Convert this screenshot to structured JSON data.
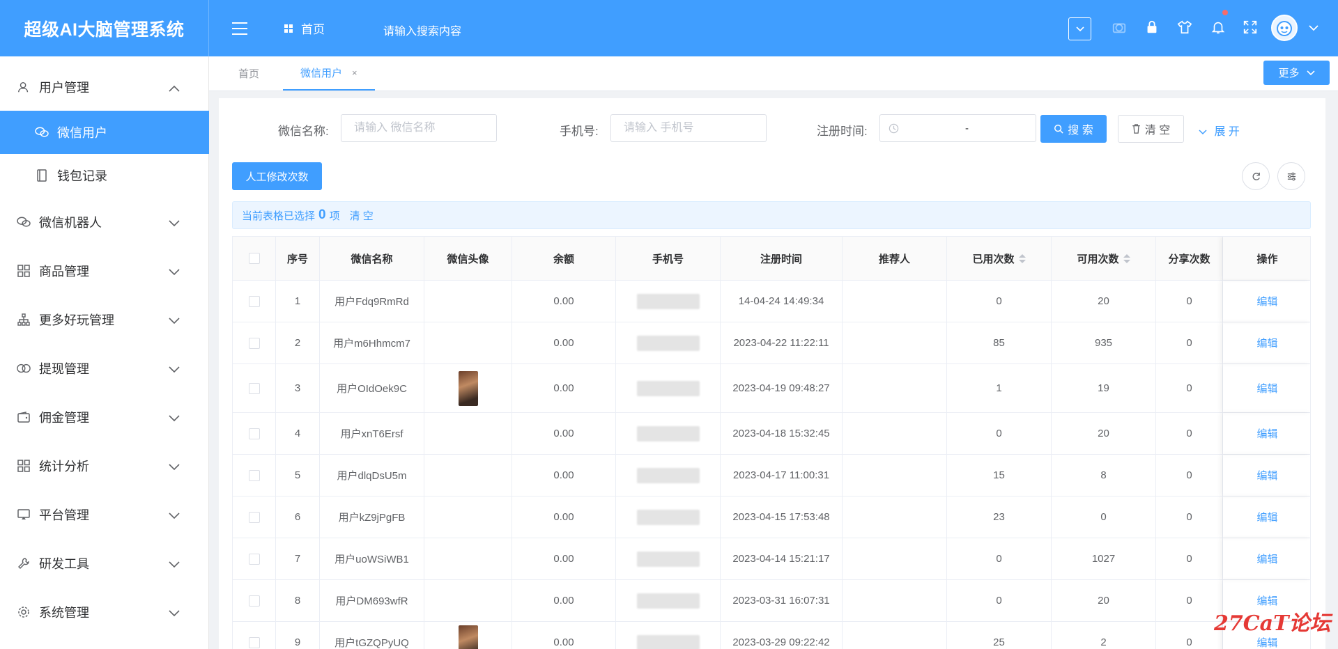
{
  "header": {
    "app_title": "超级AI大脑管理系统",
    "home_label": "首页",
    "search_placeholder": "请输入搜索内容",
    "icons": [
      "menu-icon",
      "grid-icon",
      "chevron-down-icon",
      "camera-icon",
      "lock-icon",
      "shirt-icon",
      "bell-icon",
      "fullscreen-icon",
      "avatar"
    ]
  },
  "sidebar": {
    "items": [
      {
        "label": "用户管理",
        "icon": "user-icon",
        "expanded": true
      },
      {
        "label": "微信用户",
        "icon": "chat-icon",
        "active": true
      },
      {
        "label": "钱包记录",
        "icon": "book-icon"
      },
      {
        "label": "微信机器人",
        "icon": "wechat-icon"
      },
      {
        "label": "商品管理",
        "icon": "grid-icon"
      },
      {
        "label": "更多好玩管理",
        "icon": "org-icon"
      },
      {
        "label": "提现管理",
        "icon": "circles-icon"
      },
      {
        "label": "佣金管理",
        "icon": "wallet-icon"
      },
      {
        "label": "统计分析",
        "icon": "grid-icon"
      },
      {
        "label": "平台管理",
        "icon": "screen-icon"
      },
      {
        "label": "研发工具",
        "icon": "wrench-icon"
      },
      {
        "label": "系统管理",
        "icon": "gear-icon"
      }
    ]
  },
  "tabs": {
    "items": [
      {
        "label": "首页"
      },
      {
        "label": "微信用户",
        "active": true,
        "close": "×"
      }
    ],
    "more_label": "更多"
  },
  "filters": {
    "wechat_name_label": "微信名称:",
    "wechat_name_placeholder": "请输入 微信名称",
    "phone_label": "手机号:",
    "phone_placeholder": "请输入 手机号",
    "reg_time_label": "注册时间:",
    "date_separator": "-",
    "search_label": "搜 索",
    "clear_label": "清 空",
    "expand_label": "展 开"
  },
  "toolbar": {
    "manual_edit_label": "人工修改次数"
  },
  "selection": {
    "prefix": "当前表格已选择",
    "count": "0",
    "suffix": "项",
    "clear_label": "清 空"
  },
  "table": {
    "columns": [
      "序号",
      "微信名称",
      "微信头像",
      "余额",
      "手机号",
      "注册时间",
      "推荐人",
      "已用次数",
      "可用次数",
      "分享次数",
      "操作"
    ],
    "rows": [
      {
        "index": "1",
        "name": "用户Fdq9RmRd",
        "avatar": false,
        "balance": "0.00",
        "reg_time": "14-04-24 14:49:34",
        "referrer": "",
        "used": "0",
        "available": "20",
        "shared": "0",
        "action": "编辑"
      },
      {
        "index": "2",
        "name": "用户m6Hhmcm7",
        "avatar": false,
        "balance": "0.00",
        "reg_time": "2023-04-22 11:22:11",
        "referrer": "",
        "used": "85",
        "available": "935",
        "shared": "0",
        "action": "编辑"
      },
      {
        "index": "3",
        "name": "用户OIdOek9C",
        "avatar": true,
        "balance": "0.00",
        "reg_time": "2023-04-19 09:48:27",
        "referrer": "",
        "used": "1",
        "available": "19",
        "shared": "0",
        "action": "编辑"
      },
      {
        "index": "4",
        "name": "用户xnT6Ersf",
        "avatar": false,
        "balance": "0.00",
        "reg_time": "2023-04-18 15:32:45",
        "referrer": "",
        "used": "0",
        "available": "20",
        "shared": "0",
        "action": "编辑"
      },
      {
        "index": "5",
        "name": "用户dlqDsU5m",
        "avatar": false,
        "balance": "0.00",
        "reg_time": "2023-04-17 11:00:31",
        "referrer": "",
        "used": "15",
        "available": "8",
        "shared": "0",
        "action": "编辑"
      },
      {
        "index": "6",
        "name": "用户kZ9jPgFB",
        "avatar": false,
        "balance": "0.00",
        "reg_time": "2023-04-15 17:53:48",
        "referrer": "",
        "used": "23",
        "available": "0",
        "shared": "0",
        "action": "编辑"
      },
      {
        "index": "7",
        "name": "用户uoWSiWB1",
        "avatar": false,
        "balance": "0.00",
        "reg_time": "2023-04-14 15:21:17",
        "referrer": "",
        "used": "0",
        "available": "1027",
        "shared": "0",
        "action": "编辑"
      },
      {
        "index": "8",
        "name": "用户DM693wfR",
        "avatar": false,
        "balance": "0.00",
        "reg_time": "2023-03-31 16:07:31",
        "referrer": "",
        "used": "0",
        "available": "20",
        "shared": "0",
        "action": "编辑"
      },
      {
        "index": "9",
        "name": "用户tGZQPyUQ",
        "avatar": true,
        "balance": "0.00",
        "reg_time": "2023-03-29 09:22:42",
        "referrer": "",
        "used": "25",
        "available": "2",
        "shared": "0",
        "action": "编辑"
      }
    ]
  },
  "watermark": "27CaT论坛",
  "colors": {
    "primary": "#409eff",
    "border": "#ebeef5",
    "text": "#606266",
    "danger": "#f56c6c"
  }
}
